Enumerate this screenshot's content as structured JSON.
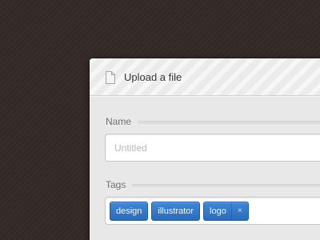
{
  "dialog": {
    "title": "Upload a file",
    "icon": "file-icon"
  },
  "form": {
    "name": {
      "label": "Name",
      "value": "",
      "placeholder": "Untitled"
    },
    "tags": {
      "label": "Tags",
      "items": [
        {
          "label": "design",
          "removable": false
        },
        {
          "label": "illustrator",
          "removable": false
        },
        {
          "label": "logo",
          "removable": true,
          "remove_icon": "×"
        }
      ]
    }
  },
  "colors": {
    "background": "#332a28",
    "dialog": "#e8e8e8",
    "tag": "#2f74c8"
  }
}
